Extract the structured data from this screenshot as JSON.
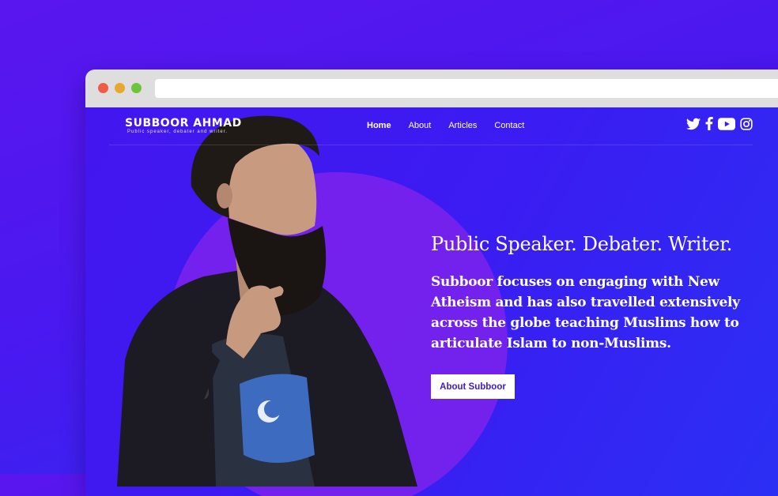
{
  "brand": {
    "name": "SUBBOOR AHMAD",
    "tagline": "Public speaker, debater and writer."
  },
  "nav": {
    "items": [
      {
        "label": "Home",
        "active": true
      },
      {
        "label": "About"
      },
      {
        "label": "Articles"
      },
      {
        "label": "Contact"
      }
    ]
  },
  "social": {
    "icons": [
      "twitter-icon",
      "facebook-icon",
      "youtube-icon",
      "instagram-icon"
    ]
  },
  "hero": {
    "title": "Public Speaker. Debater. Writer.",
    "description": "Subboor focuses on engaging with New Atheism and has also travelled extensively across the globe teaching Muslims how to articulate Islam to non-Muslims.",
    "cta_label": "About Subboor"
  },
  "colors": {
    "background": "#5a16ee",
    "accent_circle": "#7a22ec",
    "button_text": "#3d17d8"
  }
}
